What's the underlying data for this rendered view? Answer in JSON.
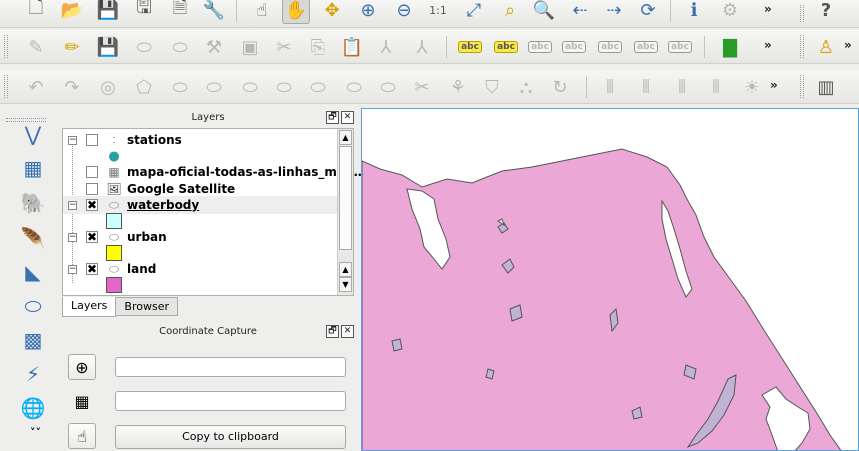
{
  "toolbars": {
    "overflow_label": "»"
  },
  "layers_dock": {
    "title": "Layers",
    "float_symbol": "🗗",
    "close_symbol": "✕",
    "layers": [
      {
        "name": "stations",
        "checked": false,
        "expanded": true,
        "checkmark": ""
      },
      {
        "name": "mapa-oficial-todas-as-linhas_mod…",
        "checked": false,
        "checkmark": ""
      },
      {
        "name": "Google Satellite",
        "checked": false,
        "checkmark": ""
      },
      {
        "name": "waterbody",
        "checked": true,
        "expanded": true,
        "checkmark": "✖",
        "swatch_color": "#ccffff"
      },
      {
        "name": "urban",
        "checked": true,
        "expanded": true,
        "checkmark": "✖",
        "swatch_color": "#ffff00"
      },
      {
        "name": "land",
        "checked": true,
        "expanded": true,
        "checkmark": "✖",
        "swatch_color": "#e066c8"
      }
    ],
    "tabs": [
      {
        "label": "Layers",
        "active": true
      },
      {
        "label": "Browser",
        "active": false
      }
    ]
  },
  "coordinate_dock": {
    "title": "Coordinate Capture",
    "field_1_value": "",
    "field_2_value": "",
    "copy_button_label": "Copy to clipboard"
  },
  "map": {
    "land_color": "#eba7d6",
    "water_color": "#ffffff",
    "urban_patch_color": "#c0b3d6",
    "border_color": "#555555",
    "selection_border_color": "#5aa0e0"
  }
}
